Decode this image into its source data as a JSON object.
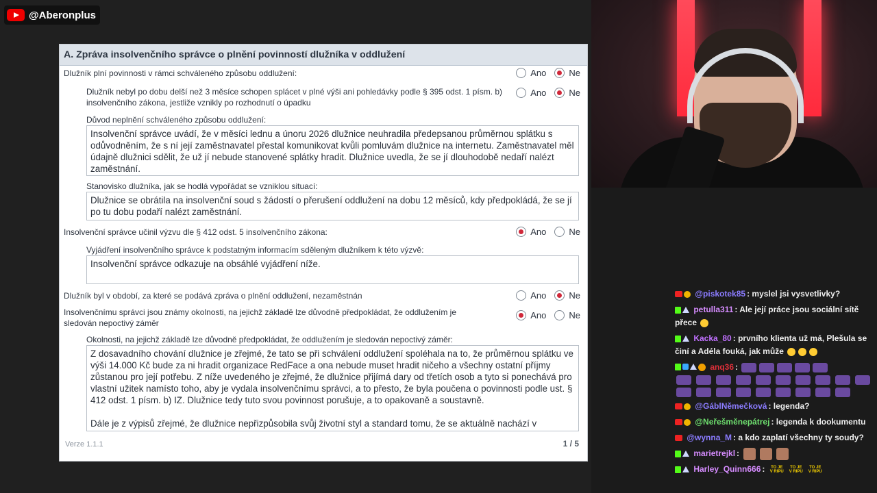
{
  "channel": {
    "handle": "@Aberonplus"
  },
  "doc": {
    "section_title": "A. Zpráva insolvenčního správce o plnění povinností dlužníka v oddlužení",
    "options": {
      "yes": "Ano",
      "no": "Ne"
    },
    "q1": {
      "text": "Dlužník plní povinnosti v rámci schváleného způsobu oddlužení:",
      "selected": "Ne"
    },
    "q2": {
      "text": "Dlužník nebyl po dobu delší než 3 měsíce schopen splácet v plné výši ani pohledávky podle § 395 odst. 1 písm. b) insolvenčního zákona, jestliže vznikly po rozhodnutí o úpadku",
      "selected": "Ne"
    },
    "reason_label": "Důvod neplnění schváleného způsobu oddlužení:",
    "reason_text": "Insolvenční správce uvádí, že v měsíci lednu a únoru 2026 dlužnice neuhradila předepsanou průměrnou splátku s odůvodněním, že s ní její zaměstnavatel přestal komunikovat kvůli pomluvám dlužnice na internetu. Zaměstnavatel měl údajně dlužnici sdělit, že už jí nebude stanovené splátky hradit. Dlužnice uvedla, že se jí dlouhodobě nedaří nalézt zaměstnání.",
    "stance_label": "Stanovisko dlužníka, jak se hodlá vypořádat se vzniklou situací:",
    "stance_text": "Dlužnice se obrátila na insolvenční soud s žádostí o přerušení oddlužení na dobu 12 měsíců, kdy předpokládá, že se jí po tu dobu podaří nalézt zaměstnání.",
    "q3": {
      "text": "Insolvenční správce učinil výzvu dle § 412 odst. 5 insolvenčního zákona:",
      "selected": "Ano"
    },
    "statement_label": "Vyjádření insolvenčního správce k podstatným informacím sděleným dlužníkem k této výzvě:",
    "statement_text": "Insolvenční správce odkazuje na obsáhlé vyjádření níže.",
    "q4": {
      "text": "Dlužník byl v období, za které se podává zpráva o plnění oddlužení, nezaměstnán",
      "selected": "Ne"
    },
    "q5": {
      "text": "Insolvenčnímu správci jsou známy okolnosti, na jejichž základě lze důvodně předpokládat, že oddlužením je sledován nepoctivý záměr",
      "selected": "Ano"
    },
    "circumstances_label": "Okolnosti, na jejichž základě lze důvodně předpokládat, že oddlužením je sledován nepoctivý záměr:",
    "circumstances_p1": "Z dosavadního chování dlužnice je zřejmé, že tato se při schválení oddlužení spoléhala na to, že průměrnou splátku ve výši 14.000 Kč bude za ni hradit organizace RedFace a ona nebude muset hradit ničeho a všechny ostatní příjmy zůstanou pro její potřebu. Z níže uvedeného je zřejmé, že dlužnice přijímá dary od třetích osob a tyto si ponechává pro vlastní užitek namísto toho, aby je vydala insolvenčnímu správci, a to přesto, že byla poučena o povinnosti podle ust. § 412 odst. 1 písm. b) IZ. Dlužnice tedy tuto svou povinnost porušuje, a to opakovaně a soustavně.",
    "circumstances_p2": "Dále je z výpisů zřejmé, že dlužnice nepřizpůsobila svůj životní styl a standard tomu, že se aktuálně nachází v",
    "version": "Verze  1.1.1",
    "page": "1 / 5"
  },
  "chat": [
    {
      "user": "@piskotek85",
      "color": "#8b7cff",
      "text": ": myslel jsi vysvetlivky?"
    },
    {
      "user": "petulla311",
      "color": "#d68cff",
      "text": ": Ale její práce jsou sociální sítě přece"
    },
    {
      "user": "Kacka_80",
      "color": "#c070ff",
      "text": ": prvního klienta už má, Plešula se činí a Adéla fouká, jak může"
    },
    {
      "user": "anq36",
      "color": "#e0303a",
      "text": ":"
    },
    {
      "user": "@GáblNěmečková",
      "color": "#8b7cff",
      "text": ": legenda?"
    },
    {
      "user": "@Neřešměnepátrej",
      "color": "#6fe06f",
      "text": ": legenda k dookumentu"
    },
    {
      "user": "@wynna_M",
      "color": "#8b7cff",
      "text": ": a kdo zaplatí všechny ty soudy?"
    },
    {
      "user": "marietrejkl",
      "color": "#d68cff",
      "text": ":"
    },
    {
      "user": "Harley_Quinn666",
      "color": "#d68cff",
      "text": ":"
    }
  ],
  "emotes": {
    "to_je_v_ripu": "TO JE V RIPU"
  },
  "colors": {
    "accent_red": "#d0283a",
    "header_bg": "#dde3ea",
    "kick_green": "#53fc18",
    "yt_red": "#ee2222"
  }
}
